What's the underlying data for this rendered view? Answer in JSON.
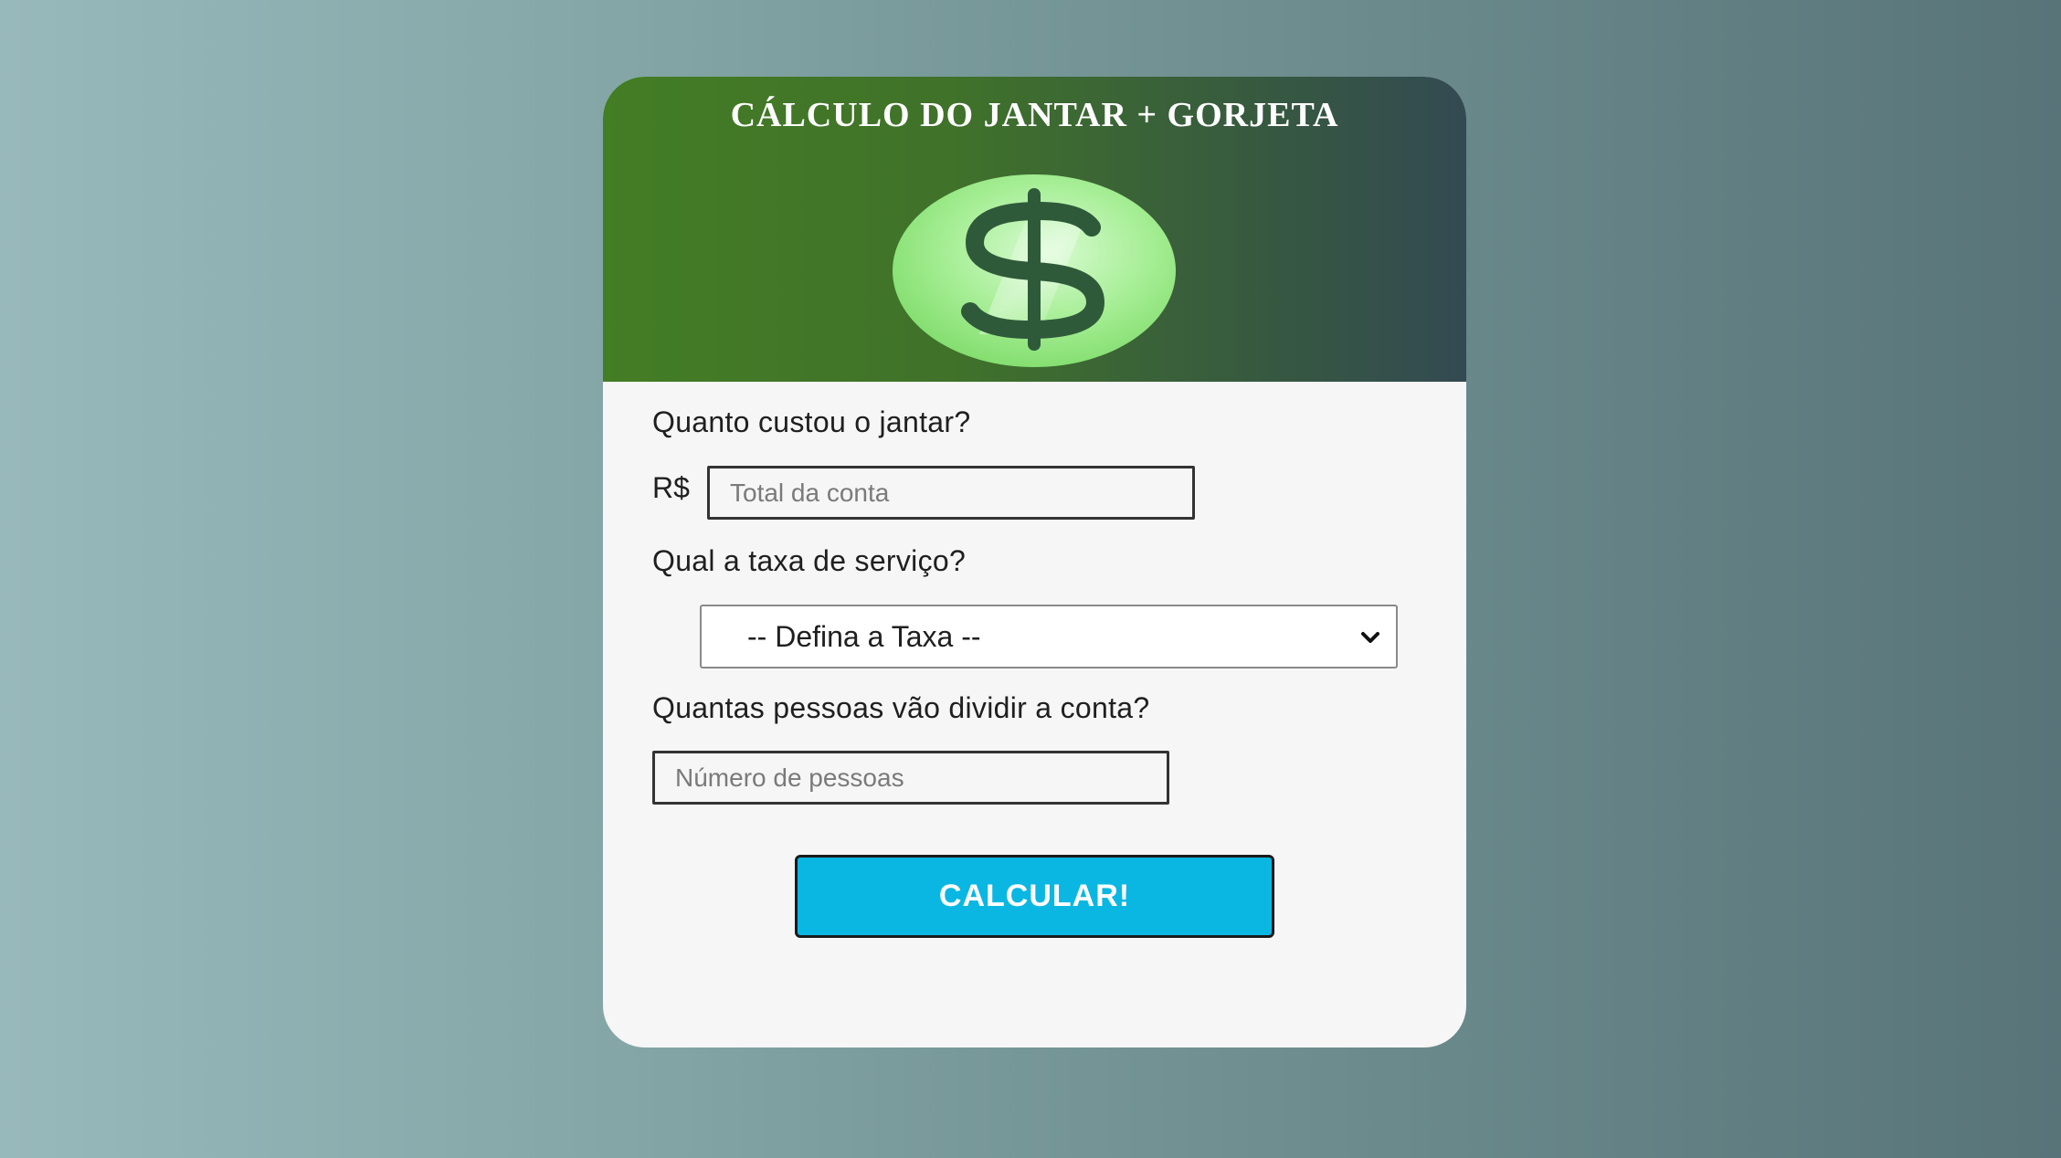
{
  "header": {
    "title": "CÁLCULO DO JANTAR + GORJETA",
    "icon": "dollar-coin-icon"
  },
  "form": {
    "bill": {
      "question": "Quanto custou o jantar?",
      "currency": "R$",
      "placeholder": "Total da conta",
      "value": ""
    },
    "service": {
      "question": "Qual a taxa de serviço?",
      "selected": "-- Defina a Taxa --"
    },
    "people": {
      "question": "Quantas pessoas vão dividir a conta?",
      "placeholder": "Número de pessoas",
      "value": ""
    },
    "submit_label": "CALCULAR!"
  },
  "colors": {
    "accent_button": "#0ab7e3",
    "header_start": "#437d24",
    "header_end": "#334a52",
    "coin_light": "#c8f5c0",
    "coin_mid": "#8fe07a",
    "dollar_sign": "#2f5a3a"
  }
}
